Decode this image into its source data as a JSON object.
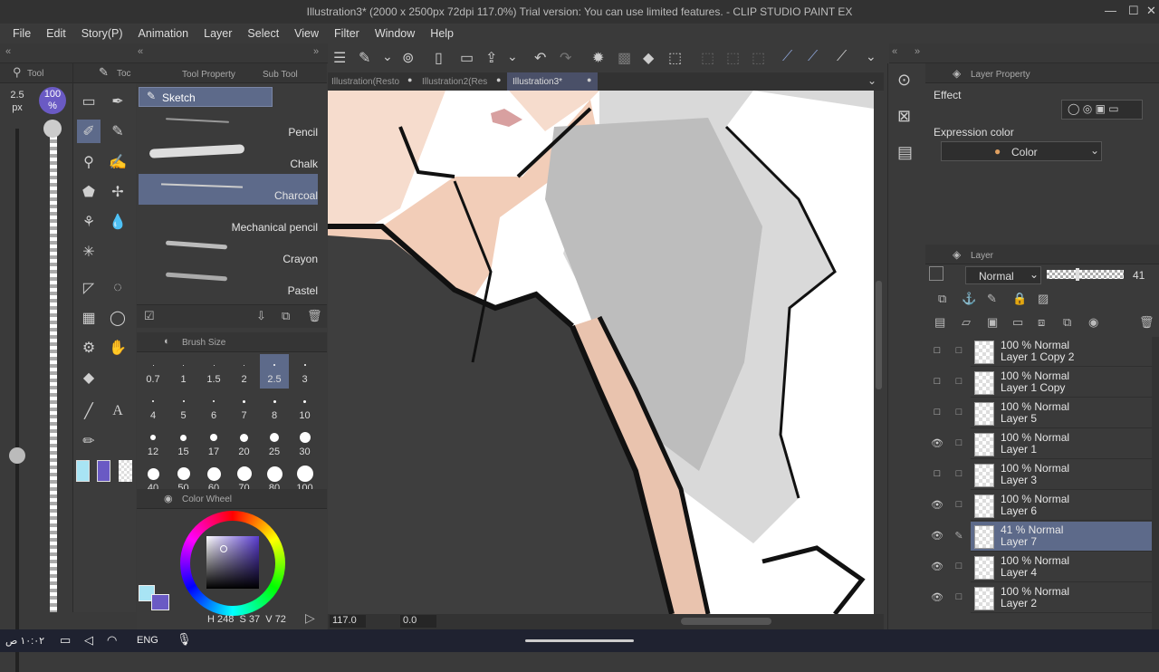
{
  "title": "Illustration3* (2000 x 2500px 72dpi 117.0%)  Trial version: You can use limited features. - CLIP STUDIO PAINT EX",
  "menu": [
    "File",
    "Edit",
    "Story(P)",
    "Animation",
    "Layer",
    "Select",
    "View",
    "Filter",
    "Window",
    "Help"
  ],
  "left": {
    "size_value": "2.5",
    "size_unit": "px",
    "opacity": "100",
    "opacity_unit": "%",
    "tab_tool": "Tool",
    "tab_toc": "Toc"
  },
  "subtool": {
    "tab_property": "Tool Property",
    "tab_sub": "Sub Tool",
    "group": "Sketch",
    "brushes": [
      "Pencil",
      "Chalk",
      "Charcoal",
      "Mechanical pencil",
      "Crayon",
      "Pastel"
    ]
  },
  "brush_size": {
    "title": "Brush Size",
    "values": [
      "0.7",
      "1",
      "1.5",
      "2",
      "2.5",
      "3",
      "4",
      "5",
      "6",
      "7",
      "8",
      "10",
      "12",
      "15",
      "17",
      "20",
      "25",
      "30",
      "40",
      "50",
      "60",
      "70",
      "80",
      "100"
    ]
  },
  "color_wheel": {
    "title": "Color Wheel",
    "h": "248",
    "s": "37",
    "v": "72",
    "s_label": "S",
    "v_label": "V",
    "h_label": "H"
  },
  "doc_tabs": [
    "Illustration(Resto",
    "Illustration2(Res",
    "Illustration3*"
  ],
  "status": {
    "zoom": "117.0",
    "angle": "0.0"
  },
  "layer_property": {
    "title": "Layer Property",
    "effect": "Effect",
    "expr_label": "Expression color",
    "expr_value": "Color"
  },
  "layer_panel": {
    "title": "Layer",
    "blend": "Normal",
    "opacity": "41",
    "layers": [
      {
        "mode": "100 % Normal",
        "name": "Layer 1 Copy 2",
        "visible": false
      },
      {
        "mode": "100 % Normal",
        "name": "Layer 1 Copy",
        "visible": false
      },
      {
        "mode": "100 % Normal",
        "name": "Layer 5",
        "visible": false
      },
      {
        "mode": "100 % Normal",
        "name": "Layer 1",
        "visible": true
      },
      {
        "mode": "100 % Normal",
        "name": "Layer 3",
        "visible": false
      },
      {
        "mode": "100 % Normal",
        "name": "Layer 6",
        "visible": true
      },
      {
        "mode": "41 % Normal",
        "name": "Layer 7",
        "visible": true,
        "selected": true
      },
      {
        "mode": "100 % Normal",
        "name": "Layer 4",
        "visible": true
      },
      {
        "mode": "100 % Normal",
        "name": "Layer 2",
        "visible": true
      }
    ]
  },
  "taskbar": {
    "time": "١٠:٠٢ ص",
    "lang": "ENG"
  },
  "colors": {
    "accent": "#5d6a8a",
    "main_color": "#a8e4f4",
    "sub_color": "#6a5ac4"
  }
}
